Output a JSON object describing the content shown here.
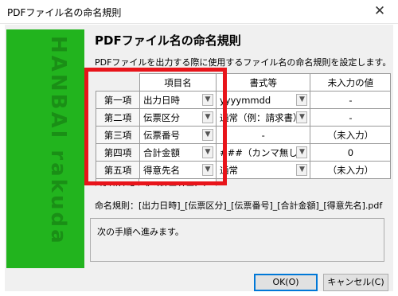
{
  "window": {
    "title": "PDFファイル名の命名規則",
    "close_label": "✕"
  },
  "banner": {
    "vertical_text": "HANBAI rakuda"
  },
  "heading": "PDFファイル名の命名規則",
  "description": "PDFファイルを出力する際に使用するファイル名の命名規則を設定します。",
  "table": {
    "headers": [
      "",
      "項目名",
      "書式等",
      "未入力の値"
    ],
    "rows": [
      {
        "label": "第一項",
        "item": "出力日時",
        "format": "yyyymmdd",
        "empty_value": "-"
      },
      {
        "label": "第二項",
        "item": "伝票区分",
        "format": "通常（例：請求書）",
        "empty_value": "-"
      },
      {
        "label": "第三項",
        "item": "伝票番号",
        "format": "-",
        "empty_value": "（未入力）"
      },
      {
        "label": "第四項",
        "item": "合計金額",
        "format": "###（カンマ無し）",
        "empty_value": "0"
      },
      {
        "label": "第五項",
        "item": "得意先名",
        "format": "通常",
        "empty_value": "（未入力）"
      }
    ],
    "extra_row": {
      "label": "区切り記号",
      "value": "アンダーバー(_)"
    }
  },
  "naming_rule": "命名規則：[出力日時]_[伝票区分]_[伝票番号]_[合計金額]_[得意先名].pdf",
  "message": "次の手順へ進みます。",
  "buttons": {
    "ok": "OK(O)",
    "cancel": "キャンセル(C)"
  },
  "colors": {
    "banner_green": "#22b41e",
    "highlight_red": "#e8141a",
    "dialog_bg": "#f0f0f0"
  },
  "icons": {
    "dropdown": "chevron-down-icon"
  }
}
